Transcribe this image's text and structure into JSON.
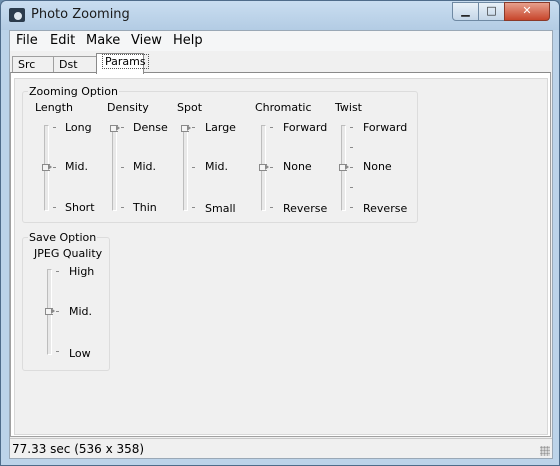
{
  "window": {
    "title": "Photo Zooming"
  },
  "menu": [
    "File",
    "Edit",
    "Make",
    "View",
    "Help"
  ],
  "tabs": [
    {
      "label": "Src",
      "active": false
    },
    {
      "label": "Dst",
      "active": false
    },
    {
      "label": "Params",
      "active": true
    }
  ],
  "zooming_option": {
    "title": "Zooming Option",
    "controls": [
      {
        "name": "Length",
        "labels": [
          "Long",
          "Mid.",
          "Short"
        ],
        "selected": "Mid."
      },
      {
        "name": "Density",
        "labels": [
          "Dense",
          "Mid.",
          "Thin"
        ],
        "selected": "Dense"
      },
      {
        "name": "Spot",
        "labels": [
          "Large",
          "Mid.",
          "Small"
        ],
        "selected": "Large"
      },
      {
        "name": "Chromatic",
        "labels": [
          "Forward",
          "None",
          "Reverse"
        ],
        "selected": "None"
      },
      {
        "name": "Twist",
        "labels": [
          "Forward",
          "None",
          "Reverse"
        ],
        "selected": "None"
      }
    ]
  },
  "save_option": {
    "title": "Save Option",
    "controls": [
      {
        "name": "JPEG Quality",
        "labels": [
          "High",
          "Mid.",
          "Low"
        ],
        "selected": "Mid."
      }
    ]
  },
  "status": {
    "text": "77.33 sec (536 x 358)"
  },
  "icons": {
    "app": "camera-icon",
    "minimize": "minimize-icon",
    "maximize": "maximize-icon",
    "close": "close-icon"
  }
}
